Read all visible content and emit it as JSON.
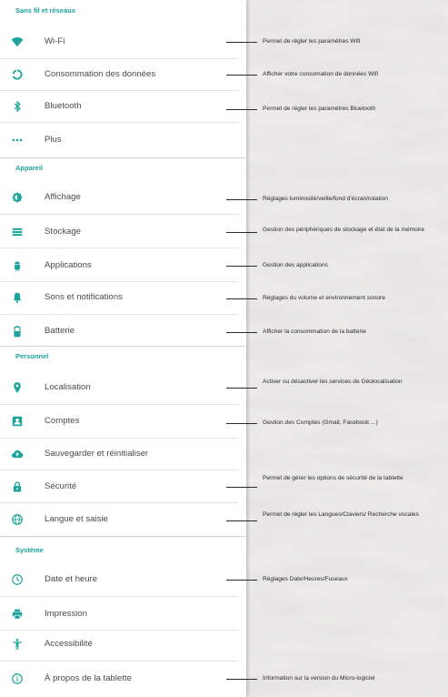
{
  "colors": {
    "accent": "#1ba39c",
    "panel": "#ffffff",
    "background": "#ebeae7"
  },
  "sections": [
    {
      "title": "Sans fil et réseaux",
      "items": [
        {
          "label": "Wi-Fi",
          "icon": "wifi-icon",
          "note": "Permet de régler les paramètres Wifi"
        },
        {
          "label": "Consommation des données",
          "icon": "data-usage-icon",
          "note": "Afficher votre consomation de données Wifi"
        },
        {
          "label": "Bluetooth",
          "icon": "bluetooth-icon",
          "note": "Permet de régler les paramètres Bluetooth"
        },
        {
          "label": "Plus",
          "icon": "more-icon",
          "note": ""
        }
      ]
    },
    {
      "title": "Appareil",
      "items": [
        {
          "label": "Affichage",
          "icon": "brightness-icon",
          "note": "Réglages luminosité/veille/fond d'écran/rotation"
        },
        {
          "label": "Stockage",
          "icon": "storage-icon",
          "note": "Gestion des périphériques de stockage et état de la mémoire"
        },
        {
          "label": "Applications",
          "icon": "android-icon",
          "note": "Gestion des applications"
        },
        {
          "label": "Sons et notifications",
          "icon": "bell-icon",
          "note": "Réglages du volume et environnement sonore"
        },
        {
          "label": "Batterie",
          "icon": "battery-icon",
          "note": "Afficher la consommation de la batterie"
        }
      ]
    },
    {
      "title": "Personnel",
      "items": [
        {
          "label": "Localisation",
          "icon": "location-icon",
          "note": "Activer ou désactiver les services de Géolocalisation"
        },
        {
          "label": "Comptes",
          "icon": "account-icon",
          "note": "Gestion des Comptes (Gmail, Facebook ...)"
        },
        {
          "label": "Sauvegarder et réinitialiser",
          "icon": "cloud-upload-icon",
          "note": ""
        },
        {
          "label": "Sécurité",
          "icon": "lock-icon",
          "note": "Permet de gérer les options de sécurité de la tablette"
        },
        {
          "label": "Langue et saisie",
          "icon": "globe-icon",
          "note": "Permet de régler les Langues/Claviers/ Recherche vocales"
        }
      ]
    },
    {
      "title": "Système",
      "items": [
        {
          "label": "Date et heure",
          "icon": "clock-icon",
          "note": "Réglages Date/Heures/Fuseaux"
        },
        {
          "label": "Impression",
          "icon": "printer-icon",
          "note": ""
        },
        {
          "label": "Accessibilité",
          "icon": "accessibility-icon",
          "note": ""
        },
        {
          "label": "À propos de la tablette",
          "icon": "info-icon",
          "note": "Information sur la version du Micro-logiciel"
        }
      ]
    }
  ]
}
